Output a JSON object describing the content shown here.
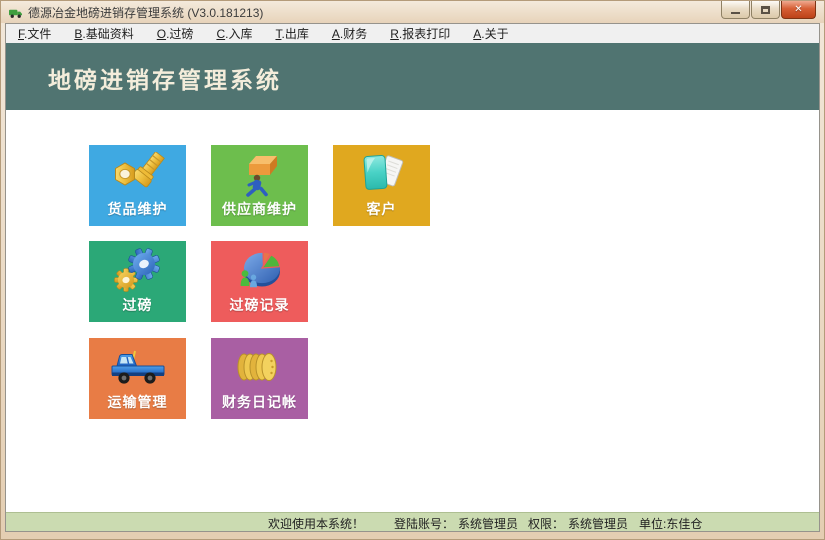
{
  "window": {
    "title": "德源冶金地磅进销存管理系统 (V3.0.181213)",
    "icons": {
      "app": "truck-icon",
      "minimize": "minimize-icon",
      "maximize": "maximize-icon",
      "close": "✕"
    }
  },
  "menu": {
    "separator": ".",
    "items": [
      {
        "key": "F",
        "label": "文件"
      },
      {
        "key": "B",
        "label": "基础资料"
      },
      {
        "key": "O",
        "label": "过磅"
      },
      {
        "key": "C",
        "label": "入库"
      },
      {
        "key": "T",
        "label": "出库"
      },
      {
        "key": "A",
        "label": "财务"
      },
      {
        "key": "R",
        "label": "报表打印"
      },
      {
        "key": "A",
        "label": "关于"
      }
    ]
  },
  "banner": {
    "title": "地磅进销存管理系统",
    "background": "#507471",
    "text_color": "#F4EDDB"
  },
  "tiles": [
    {
      "label": "货品维护",
      "color": "#3FA9E2",
      "icon": "nut-bolt-icon"
    },
    {
      "label": "供应商维护",
      "color": "#6DBE4D",
      "icon": "supplier-carrier-icon"
    },
    {
      "label": "客户",
      "color": "#E0A81F",
      "icon": "cards-icon"
    },
    {
      "label": "过磅",
      "color": "#2BA877",
      "icon": "gears-icon"
    },
    {
      "label": "过磅记录",
      "color": "#EE5C5C",
      "icon": "pie-chart-icon"
    },
    {
      "label": "运输管理",
      "color": "#E87C45",
      "icon": "truck-icon"
    },
    {
      "label": "财务日记帐",
      "color": "#A95FA3",
      "icon": "coins-icon"
    }
  ],
  "statusbar": {
    "background": "#CBDBB1",
    "welcome": "欢迎使用本系统！",
    "account_label": "登陆账号：",
    "account": "系统管理员",
    "permission_label": "权限：",
    "permission": "系统管理员",
    "unit": "单位:东佳仓"
  }
}
